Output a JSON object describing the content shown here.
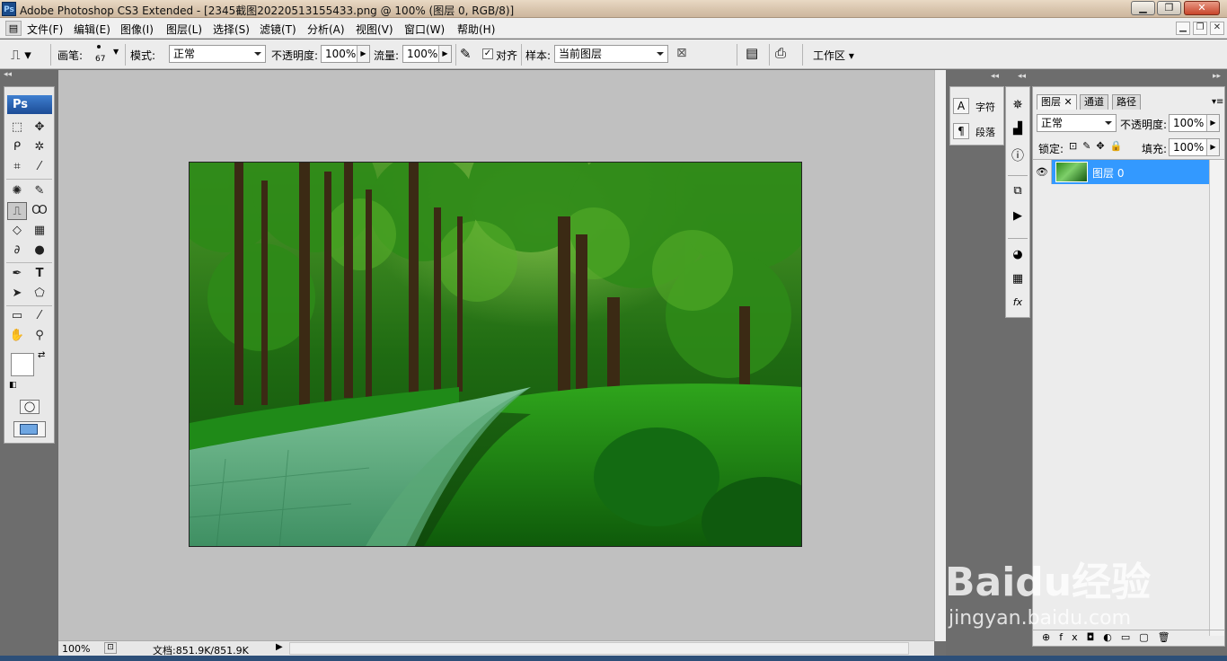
{
  "window": {
    "title": "Adobe Photoshop CS3 Extended - [2345截图20220513155433.png @ 100% (图层 0, RGB/8)]",
    "ps_logo": "Ps",
    "controls": [
      "minimize",
      "maximize",
      "close"
    ]
  },
  "menu": {
    "items": [
      "文件(F)",
      "编辑(E)",
      "图像(I)",
      "图层(L)",
      "选择(S)",
      "滤镜(T)",
      "分析(A)",
      "视图(V)",
      "窗口(W)",
      "帮助(H)"
    ]
  },
  "options": {
    "brush_label": "画笔:",
    "brush_size": "67",
    "mode_label": "模式:",
    "mode_value": "正常",
    "opacity_label": "不透明度:",
    "opacity_value": "100%",
    "flow_label": "流量:",
    "flow_value": "100%",
    "align_label": "对齐",
    "align_checked": true,
    "sample_label": "样本:",
    "sample_value": "当前图层",
    "workspace_label": "工作区"
  },
  "tools": {
    "logo": "Ps"
  },
  "status": {
    "zoom": "100%",
    "doc_info": "文档:851.9K/851.9K"
  },
  "char_panel": {
    "items": [
      {
        "icon": "character-icon",
        "label": "字符"
      },
      {
        "icon": "paragraph-icon",
        "label": "段落"
      }
    ]
  },
  "layers_panel": {
    "tabs": [
      "图层",
      "通道",
      "路径"
    ],
    "blend_mode": "正常",
    "opacity_label": "不透明度:",
    "opacity_value": "100%",
    "lock_label": "锁定:",
    "fill_label": "填充:",
    "fill_value": "100%",
    "layers": [
      {
        "name": "图层 0",
        "visible": true,
        "selected": true
      }
    ]
  },
  "watermark": {
    "line1": "Baidu经验",
    "line2": "jingyan.baidu.com"
  },
  "colors": {
    "selection_blue": "#3399ff",
    "canvas_bg": "#c0c0c0",
    "dock_bg": "#6d6d6d"
  }
}
